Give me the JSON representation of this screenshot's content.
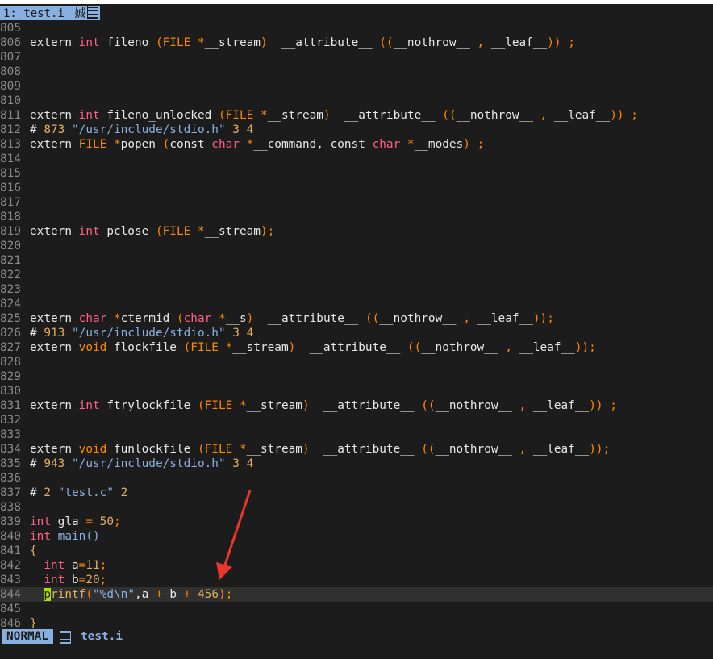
{
  "tabline": {
    "tab_number": "1:",
    "tab_name": "test.i",
    "tab_extra": "娍"
  },
  "editor": {
    "lines": [
      {
        "n": "805",
        "tokens": []
      },
      {
        "n": "806",
        "tokens": [
          [
            "kw",
            "extern "
          ],
          [
            "ty-int",
            "int"
          ],
          [
            "kw",
            " fileno "
          ],
          [
            "punc",
            "("
          ],
          [
            "type",
            "FILE"
          ],
          [
            "kw",
            " "
          ],
          [
            "op",
            "*"
          ],
          [
            "kw",
            "__stream"
          ],
          [
            "punc",
            ")"
          ],
          [
            "kw",
            "  __attribute__ "
          ],
          [
            "punc",
            "(("
          ],
          [
            "kw",
            "__nothrow__ "
          ],
          [
            "punc",
            ","
          ],
          [
            "kw",
            " __leaf__"
          ],
          [
            "punc",
            "))"
          ],
          [
            "kw",
            " "
          ],
          [
            "punc",
            ";"
          ]
        ]
      },
      {
        "n": "807",
        "tokens": []
      },
      {
        "n": "808",
        "tokens": []
      },
      {
        "n": "809",
        "tokens": []
      },
      {
        "n": "810",
        "tokens": []
      },
      {
        "n": "811",
        "tokens": [
          [
            "kw",
            "extern "
          ],
          [
            "ty-int",
            "int"
          ],
          [
            "kw",
            " fileno_unlocked "
          ],
          [
            "punc",
            "("
          ],
          [
            "type",
            "FILE"
          ],
          [
            "kw",
            " "
          ],
          [
            "op",
            "*"
          ],
          [
            "kw",
            "__stream"
          ],
          [
            "punc",
            ")"
          ],
          [
            "kw",
            "  __attribute__ "
          ],
          [
            "punc",
            "(("
          ],
          [
            "kw",
            "__nothrow__ "
          ],
          [
            "punc",
            ","
          ],
          [
            "kw",
            " __leaf__"
          ],
          [
            "punc",
            "))"
          ],
          [
            "kw",
            " "
          ],
          [
            "punc",
            ";"
          ]
        ]
      },
      {
        "n": "812",
        "tokens": [
          [
            "pre",
            "# "
          ],
          [
            "num",
            "873"
          ],
          [
            "kw",
            " "
          ],
          [
            "str",
            "\"/usr/include/stdio.h\""
          ],
          [
            "kw",
            " "
          ],
          [
            "num",
            "3"
          ],
          [
            "kw",
            " "
          ],
          [
            "num",
            "4"
          ]
        ]
      },
      {
        "n": "813",
        "tokens": [
          [
            "kw",
            "extern "
          ],
          [
            "type",
            "FILE"
          ],
          [
            "kw",
            " "
          ],
          [
            "op",
            "*"
          ],
          [
            "kw",
            "popen "
          ],
          [
            "punc",
            "("
          ],
          [
            "kw",
            "const "
          ],
          [
            "type2",
            "char"
          ],
          [
            "kw",
            " "
          ],
          [
            "op",
            "*"
          ],
          [
            "kw",
            "__command, const "
          ],
          [
            "type2",
            "char"
          ],
          [
            "kw",
            " "
          ],
          [
            "op",
            "*"
          ],
          [
            "kw",
            "__modes"
          ],
          [
            "punc",
            ")"
          ],
          [
            "kw",
            " "
          ],
          [
            "punc",
            ";"
          ]
        ]
      },
      {
        "n": "814",
        "tokens": []
      },
      {
        "n": "815",
        "tokens": []
      },
      {
        "n": "816",
        "tokens": []
      },
      {
        "n": "817",
        "tokens": []
      },
      {
        "n": "818",
        "tokens": []
      },
      {
        "n": "819",
        "tokens": [
          [
            "kw",
            "extern "
          ],
          [
            "ty-int",
            "int"
          ],
          [
            "kw",
            " pclose "
          ],
          [
            "punc",
            "("
          ],
          [
            "type",
            "FILE"
          ],
          [
            "kw",
            " "
          ],
          [
            "op",
            "*"
          ],
          [
            "kw",
            "__stream"
          ],
          [
            "punc",
            ");"
          ]
        ]
      },
      {
        "n": "820",
        "tokens": []
      },
      {
        "n": "821",
        "tokens": []
      },
      {
        "n": "822",
        "tokens": []
      },
      {
        "n": "823",
        "tokens": []
      },
      {
        "n": "824",
        "tokens": []
      },
      {
        "n": "825",
        "tokens": [
          [
            "kw",
            "extern "
          ],
          [
            "type2",
            "char"
          ],
          [
            "kw",
            " "
          ],
          [
            "op",
            "*"
          ],
          [
            "kw",
            "ctermid "
          ],
          [
            "punc",
            "("
          ],
          [
            "type2",
            "char"
          ],
          [
            "kw",
            " "
          ],
          [
            "op",
            "*"
          ],
          [
            "kw",
            "__s"
          ],
          [
            "punc",
            ")"
          ],
          [
            "kw",
            "  __attribute__ "
          ],
          [
            "punc",
            "(("
          ],
          [
            "kw",
            "__nothrow__ "
          ],
          [
            "punc",
            ","
          ],
          [
            "kw",
            " __leaf__"
          ],
          [
            "punc",
            "));"
          ]
        ]
      },
      {
        "n": "826",
        "tokens": [
          [
            "pre",
            "# "
          ],
          [
            "num",
            "913"
          ],
          [
            "kw",
            " "
          ],
          [
            "str",
            "\"/usr/include/stdio.h\""
          ],
          [
            "kw",
            " "
          ],
          [
            "num",
            "3"
          ],
          [
            "kw",
            " "
          ],
          [
            "num",
            "4"
          ]
        ]
      },
      {
        "n": "827",
        "tokens": [
          [
            "kw",
            "extern "
          ],
          [
            "type",
            "void"
          ],
          [
            "kw",
            " flockfile "
          ],
          [
            "punc",
            "("
          ],
          [
            "type",
            "FILE"
          ],
          [
            "kw",
            " "
          ],
          [
            "op",
            "*"
          ],
          [
            "kw",
            "__stream"
          ],
          [
            "punc",
            ")"
          ],
          [
            "kw",
            "  __attribute__ "
          ],
          [
            "punc",
            "(("
          ],
          [
            "kw",
            "__nothrow__ "
          ],
          [
            "punc",
            ","
          ],
          [
            "kw",
            " __leaf__"
          ],
          [
            "punc",
            "));"
          ]
        ]
      },
      {
        "n": "828",
        "tokens": []
      },
      {
        "n": "829",
        "tokens": []
      },
      {
        "n": "830",
        "tokens": []
      },
      {
        "n": "831",
        "tokens": [
          [
            "kw",
            "extern "
          ],
          [
            "ty-int",
            "int"
          ],
          [
            "kw",
            " ftrylockfile "
          ],
          [
            "punc",
            "("
          ],
          [
            "type",
            "FILE"
          ],
          [
            "kw",
            " "
          ],
          [
            "op",
            "*"
          ],
          [
            "kw",
            "__stream"
          ],
          [
            "punc",
            ")"
          ],
          [
            "kw",
            "  __attribute__ "
          ],
          [
            "punc",
            "(("
          ],
          [
            "kw",
            "__nothrow__ "
          ],
          [
            "punc",
            ","
          ],
          [
            "kw",
            " __leaf__"
          ],
          [
            "punc",
            "))"
          ],
          [
            "kw",
            " "
          ],
          [
            "punc",
            ";"
          ]
        ]
      },
      {
        "n": "832",
        "tokens": []
      },
      {
        "n": "833",
        "tokens": []
      },
      {
        "n": "834",
        "tokens": [
          [
            "kw",
            "extern "
          ],
          [
            "type",
            "void"
          ],
          [
            "kw",
            " funlockfile "
          ],
          [
            "punc",
            "("
          ],
          [
            "type",
            "FILE"
          ],
          [
            "kw",
            " "
          ],
          [
            "op",
            "*"
          ],
          [
            "kw",
            "__stream"
          ],
          [
            "punc",
            ")"
          ],
          [
            "kw",
            "  __attribute__ "
          ],
          [
            "punc",
            "(("
          ],
          [
            "kw",
            "__nothrow__ "
          ],
          [
            "punc",
            ","
          ],
          [
            "kw",
            " __leaf__"
          ],
          [
            "punc",
            "));"
          ]
        ]
      },
      {
        "n": "835",
        "tokens": [
          [
            "pre",
            "# "
          ],
          [
            "num",
            "943"
          ],
          [
            "kw",
            " "
          ],
          [
            "str",
            "\"/usr/include/stdio.h\""
          ],
          [
            "kw",
            " "
          ],
          [
            "num",
            "3"
          ],
          [
            "kw",
            " "
          ],
          [
            "num",
            "4"
          ]
        ]
      },
      {
        "n": "836",
        "tokens": []
      },
      {
        "n": "837",
        "tokens": [
          [
            "pre",
            "# "
          ],
          [
            "num",
            "2"
          ],
          [
            "kw",
            " "
          ],
          [
            "str",
            "\"test.c\""
          ],
          [
            "kw",
            " "
          ],
          [
            "num",
            "2"
          ]
        ]
      },
      {
        "n": "838",
        "tokens": []
      },
      {
        "n": "839",
        "tokens": [
          [
            "ty-int",
            "int"
          ],
          [
            "kw",
            " gla "
          ],
          [
            "op",
            "="
          ],
          [
            "kw",
            " "
          ],
          [
            "num",
            "50"
          ],
          [
            "punc",
            ";"
          ]
        ]
      },
      {
        "n": "840",
        "tokens": [
          [
            "ty-int",
            "int"
          ],
          [
            "kw",
            " "
          ],
          [
            "fn",
            "main"
          ],
          [
            "fn",
            "()"
          ]
        ]
      },
      {
        "n": "841",
        "tokens": [
          [
            "num",
            "{"
          ]
        ]
      },
      {
        "n": "842",
        "tokens": [
          [
            "kw",
            "  "
          ],
          [
            "ty-int",
            "int"
          ],
          [
            "kw",
            " a"
          ],
          [
            "op",
            "="
          ],
          [
            "num",
            "11"
          ],
          [
            "punc",
            ";"
          ]
        ]
      },
      {
        "n": "843",
        "tokens": [
          [
            "kw",
            "  "
          ],
          [
            "ty-int",
            "int"
          ],
          [
            "kw",
            " b"
          ],
          [
            "op",
            "="
          ],
          [
            "num",
            "20"
          ],
          [
            "punc",
            ";"
          ]
        ]
      },
      {
        "n": "844",
        "cursorline": true,
        "tokens": [
          [
            "kw",
            "  "
          ],
          [
            "cursor",
            "p"
          ],
          [
            "num",
            "rintf"
          ],
          [
            "punc",
            "("
          ],
          [
            "str",
            "\"%d\\n\""
          ],
          [
            "kw",
            ",a "
          ],
          [
            "op",
            "+"
          ],
          [
            "kw",
            " b "
          ],
          [
            "op",
            "+"
          ],
          [
            "kw",
            " "
          ],
          [
            "num",
            "456"
          ],
          [
            "punc",
            ");"
          ]
        ]
      },
      {
        "n": "845",
        "tokens": []
      },
      {
        "n": "846",
        "tokens": [
          [
            "num",
            "}"
          ]
        ]
      }
    ]
  },
  "statusline": {
    "mode": "NORMAL",
    "filename": "test.i"
  },
  "colors": {
    "background": "#1c1c1c",
    "accent": "#87afdf",
    "arrow": "#e8362d"
  }
}
